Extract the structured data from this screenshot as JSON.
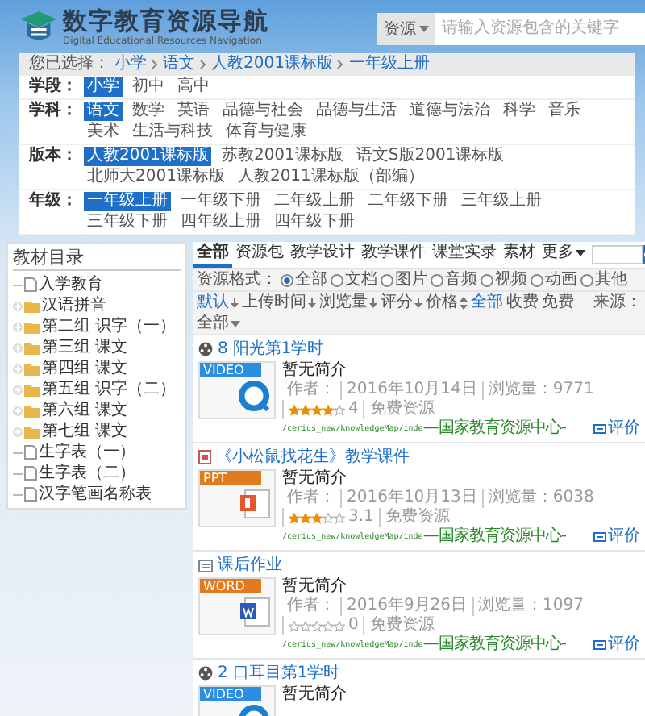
{
  "header": {
    "title": "数字教育资源导航",
    "subtitle": "Digital Educational Resources Navigation",
    "search": {
      "scope": "资源",
      "placeholder": "请输入资源包含的关键字"
    }
  },
  "breadcrumb": {
    "label": "您已选择：",
    "items": [
      "小学",
      "语文",
      "人教2001课标版",
      "一年级上册"
    ]
  },
  "filters": [
    {
      "label": "学段：",
      "options": [
        {
          "label": "小学",
          "selected": true
        },
        {
          "label": "初中",
          "selected": false
        },
        {
          "label": "高中",
          "selected": false
        }
      ]
    },
    {
      "label": "学科：",
      "options": [
        {
          "label": "语文",
          "selected": true
        },
        {
          "label": "数学",
          "selected": false
        },
        {
          "label": "英语",
          "selected": false
        },
        {
          "label": "品德与社会",
          "selected": false
        },
        {
          "label": "品德与生活",
          "selected": false
        },
        {
          "label": "道德与法治",
          "selected": false
        },
        {
          "label": "科学",
          "selected": false
        },
        {
          "label": "音乐",
          "selected": false
        },
        {
          "label": "美术",
          "selected": false
        },
        {
          "label": "生活与科技",
          "selected": false
        },
        {
          "label": "体育与健康",
          "selected": false
        }
      ]
    },
    {
      "label": "版本：",
      "options": [
        {
          "label": "人教2001课标版",
          "selected": true
        },
        {
          "label": "苏教2001课标版",
          "selected": false
        },
        {
          "label": "语文S版2001课标版",
          "selected": false
        },
        {
          "label": "北师大2001课标版",
          "selected": false
        },
        {
          "label": "人教2011课标版（部编）",
          "selected": false
        }
      ]
    },
    {
      "label": "年级：",
      "options": [
        {
          "label": "一年级上册",
          "selected": true
        },
        {
          "label": "一年级下册",
          "selected": false
        },
        {
          "label": "二年级上册",
          "selected": false
        },
        {
          "label": "二年级下册",
          "selected": false
        },
        {
          "label": "三年级上册",
          "selected": false
        },
        {
          "label": "三年级下册",
          "selected": false
        },
        {
          "label": "四年级上册",
          "selected": false
        },
        {
          "label": "四年级下册",
          "selected": false
        }
      ]
    }
  ],
  "sidebar": {
    "title": "教材目录",
    "tree": [
      {
        "label": "入学教育",
        "kind": "file"
      },
      {
        "label": "汉语拼音",
        "kind": "folder"
      },
      {
        "label": "第二组 识字（一）",
        "kind": "folder"
      },
      {
        "label": "第三组 课文",
        "kind": "folder"
      },
      {
        "label": "第四组 课文",
        "kind": "folder"
      },
      {
        "label": "第五组 识字（二）",
        "kind": "folder"
      },
      {
        "label": "第六组 课文",
        "kind": "folder"
      },
      {
        "label": "第七组 课文",
        "kind": "folder"
      },
      {
        "label": "生字表（一）",
        "kind": "file"
      },
      {
        "label": "生字表（二）",
        "kind": "file"
      },
      {
        "label": "汉字笔画名称表",
        "kind": "file"
      }
    ]
  },
  "tabs": [
    {
      "label": "全部",
      "selected": true,
      "kind": "tab"
    },
    {
      "label": "资源包",
      "selected": false,
      "kind": "tab"
    },
    {
      "label": "教学设计",
      "selected": false,
      "kind": "tab"
    },
    {
      "label": "教学课件",
      "selected": false,
      "kind": "tab"
    },
    {
      "label": "课堂实录",
      "selected": false,
      "kind": "tab"
    },
    {
      "label": "素材",
      "selected": false,
      "kind": "tab"
    },
    {
      "label": "更多",
      "selected": false,
      "kind": "dropdown"
    }
  ],
  "format": {
    "label": "资源格式：",
    "options": [
      {
        "label": "全部",
        "selected": true
      },
      {
        "label": "文档",
        "selected": false
      },
      {
        "label": "图片",
        "selected": false
      },
      {
        "label": "音频",
        "selected": false
      },
      {
        "label": "视频",
        "selected": false
      },
      {
        "label": "动画",
        "selected": false
      },
      {
        "label": "其他",
        "selected": false
      }
    ]
  },
  "sort": {
    "keys": [
      {
        "label": "默认",
        "selected": true,
        "kind": "down"
      },
      {
        "label": "上传时间",
        "selected": false,
        "kind": "down"
      },
      {
        "label": "浏览量",
        "selected": false,
        "kind": "down"
      },
      {
        "label": "评分",
        "selected": false,
        "kind": "down"
      },
      {
        "label": "价格",
        "selected": false,
        "kind": "both"
      }
    ],
    "prices": [
      {
        "label": "全部",
        "selected": true
      },
      {
        "label": "收费",
        "selected": false
      },
      {
        "label": "免费",
        "selected": false
      }
    ],
    "source_label": "来源：",
    "source_value": "全部"
  },
  "resources": [
    {
      "kind": "video",
      "number": "8",
      "title": "阳光第1学时",
      "badge": "VIDEO",
      "summary": "暂无简介",
      "author": "作者：",
      "date": "2016年10月14日",
      "views": "浏览量：9771",
      "stars": 4,
      "score": "4",
      "price": "免费资源",
      "path": "/cerius_new/knowledgeMap/inde",
      "source": "—国家教育资源中心-",
      "review": "评价"
    },
    {
      "kind": "ppt",
      "title": "《小松鼠找花生》教学课件",
      "badge": "PPT",
      "summary": "暂无简介",
      "author": "作者：",
      "date": "2016年10月13日",
      "views": "浏览量：6038",
      "stars": 3,
      "score": "3.1",
      "price": "免费资源",
      "path": "/cerius_new/knowledgeMap/inde",
      "source": "—国家教育资源中心-",
      "review": "评价"
    },
    {
      "kind": "word",
      "title": "课后作业",
      "badge": "WORD",
      "summary": "暂无简介",
      "author": "作者：",
      "date": "2016年9月26日",
      "views": "浏览量：1097",
      "stars": 0,
      "score": "0",
      "price": "免费资源",
      "path": "/cerius_new/knowledgeMap/inde",
      "source": "—国家教育资源中心-",
      "review": "评价"
    },
    {
      "kind": "video",
      "number": "2",
      "title": "口耳目第1学时",
      "badge": "VIDEO",
      "summary": "暂无简介"
    }
  ]
}
